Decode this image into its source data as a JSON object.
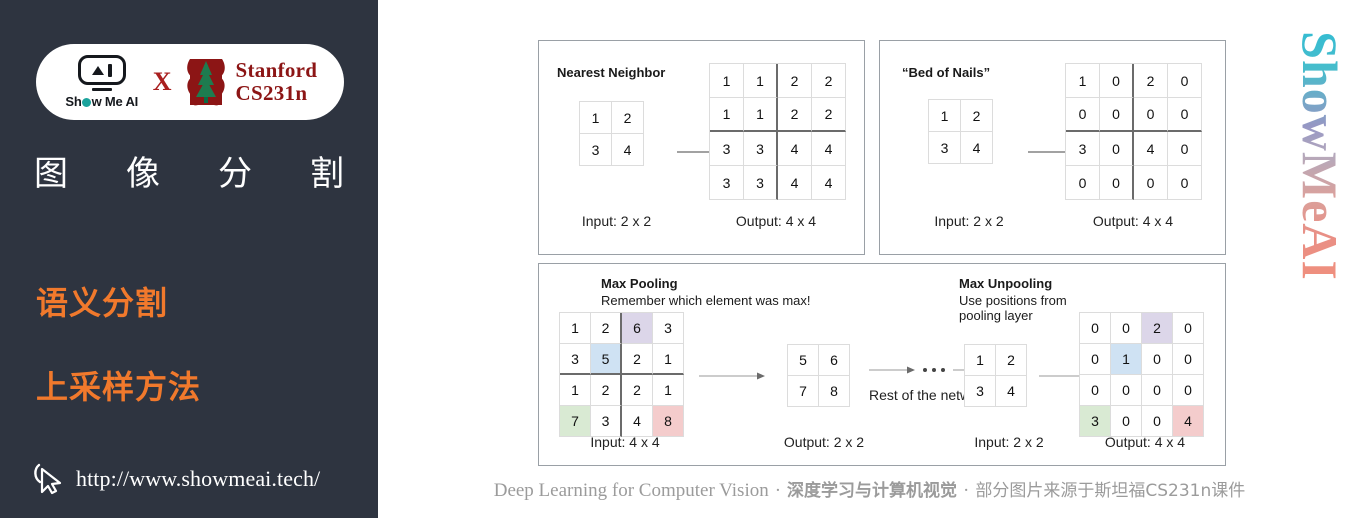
{
  "sidebar": {
    "logo": {
      "showmeai_text": "Show Me AI",
      "x_symbol": "X",
      "stanford_line1": "Stanford",
      "stanford_line2": "CS231n"
    },
    "title_chars": [
      "图",
      "像",
      "分",
      "割"
    ],
    "bullets": [
      "语义分割",
      "上采样方法"
    ],
    "url": "http://www.showmeai.tech/",
    "bg_color": "#2E3440",
    "accent_color": "#F1792C"
  },
  "main": {
    "watermark": "ShowMeAI",
    "footer": {
      "en": "Deep Learning for Computer Vision",
      "cn_bold": "深度学习与计算机视觉",
      "cn_note": "部分图片来源于斯坦福CS231n课件",
      "separator": "·"
    }
  },
  "chart_data": [
    {
      "type": "table",
      "title": "Nearest Neighbor",
      "input_caption": "Input: 2 x 2",
      "output_caption": "Output: 4 x 4",
      "input": [
        [
          1,
          2
        ],
        [
          3,
          4
        ]
      ],
      "output": [
        [
          1,
          1,
          2,
          2
        ],
        [
          1,
          1,
          2,
          2
        ],
        [
          3,
          3,
          4,
          4
        ],
        [
          3,
          3,
          4,
          4
        ]
      ]
    },
    {
      "type": "table",
      "title": "“Bed of Nails”",
      "input_caption": "Input: 2 x 2",
      "output_caption": "Output: 4 x 4",
      "input": [
        [
          1,
          2
        ],
        [
          3,
          4
        ]
      ],
      "output": [
        [
          1,
          0,
          2,
          0
        ],
        [
          0,
          0,
          0,
          0
        ],
        [
          3,
          0,
          4,
          0
        ],
        [
          0,
          0,
          0,
          0
        ]
      ]
    },
    {
      "type": "table",
      "title": "Max Pooling",
      "subtitle": "Remember which element was max!",
      "input_caption": "Input: 4 x 4",
      "output_caption": "Output: 2 x 2",
      "middle_label": "Rest of the network",
      "input": [
        [
          1,
          2,
          6,
          3
        ],
        [
          3,
          5,
          2,
          1
        ],
        [
          1,
          2,
          2,
          1
        ],
        [
          7,
          3,
          4,
          8
        ]
      ],
      "output": [
        [
          5,
          6
        ],
        [
          7,
          8
        ]
      ],
      "highlights": [
        {
          "r": 0,
          "c": 2,
          "color": "#DCD6E9"
        },
        {
          "r": 1,
          "c": 1,
          "color": "#CFE2F3"
        },
        {
          "r": 3,
          "c": 0,
          "color": "#D9EAD3"
        },
        {
          "r": 3,
          "c": 3,
          "color": "#F4CCCC"
        }
      ]
    },
    {
      "type": "table",
      "title": "Max Unpooling",
      "subtitle": "Use positions from pooling layer",
      "input_caption": "Input: 2 x 2",
      "output_caption": "Output: 4 x 4",
      "input": [
        [
          1,
          2
        ],
        [
          3,
          4
        ]
      ],
      "output": [
        [
          0,
          0,
          2,
          0
        ],
        [
          0,
          1,
          0,
          0
        ],
        [
          0,
          0,
          0,
          0
        ],
        [
          3,
          0,
          0,
          4
        ]
      ],
      "highlights": [
        {
          "r": 0,
          "c": 2,
          "color": "#DCD6E9"
        },
        {
          "r": 1,
          "c": 1,
          "color": "#CFE2F3"
        },
        {
          "r": 3,
          "c": 0,
          "color": "#D9EAD3"
        },
        {
          "r": 3,
          "c": 3,
          "color": "#F4CCCC"
        }
      ]
    }
  ]
}
